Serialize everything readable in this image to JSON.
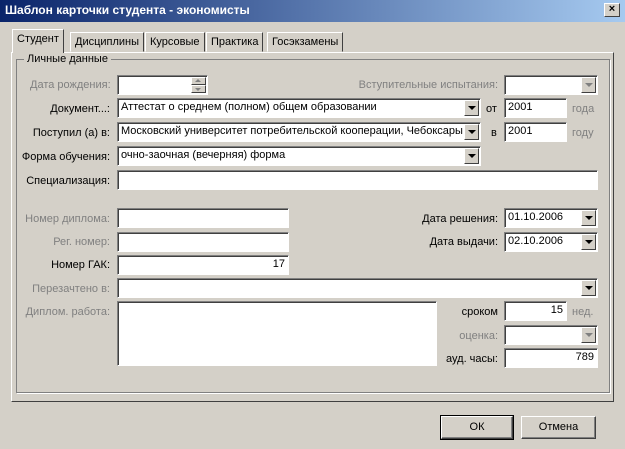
{
  "window": {
    "title": "Шаблон карточки студента - экономисты",
    "close_glyph": "×"
  },
  "tabs": [
    "Студент",
    "Дисциплины",
    "Курсовые",
    "Практика",
    "Госэкзамены"
  ],
  "group": {
    "title": "Личные данные"
  },
  "labels": {
    "birth_date": "Дата рождения:",
    "entrance_exams": "Вступительные испытания:",
    "document": "Документ...:",
    "from": "от",
    "year": "года",
    "enrolled": "Поступил (а) в:",
    "in": "в",
    "year2": "году",
    "study_form": "Форма обучения:",
    "specialization": "Специализация:",
    "diploma_number": "Номер диплома:",
    "reg_number": "Рег. номер:",
    "gak_number": "Номер ГАК:",
    "credited_in": "Перезачтено в:",
    "diploma_work": "Диплом. работа:",
    "decision_date": "Дата решения:",
    "issue_date": "Дата выдачи:",
    "term": "сроком",
    "weeks": "нед.",
    "grade": "оценка:",
    "aud_hours": "ауд. часы:"
  },
  "values": {
    "birth_date": "",
    "entrance_exams": "",
    "document": "Аттестат о среднем (полном) общем образовании",
    "document_year": "2001",
    "enrolled": "Московский университет потребительской кооперации, Чебоксары",
    "enrolled_year": "2001",
    "study_form": "очно-заочная (вечерняя) форма",
    "specialization": "",
    "diploma_number": "",
    "reg_number": "",
    "gak_number": "17",
    "credited_in": "",
    "diploma_work": "",
    "decision_date": "01.10.2006",
    "issue_date": "02.10.2006",
    "term": "15",
    "grade": "",
    "aud_hours": "789"
  },
  "buttons": {
    "ok": "ОК",
    "cancel": "Отмена"
  }
}
